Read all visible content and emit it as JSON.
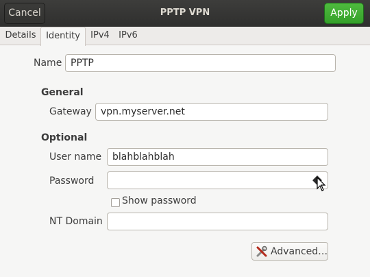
{
  "window": {
    "title": "PPTP VPN",
    "cancel_label": "Cancel",
    "apply_label": "Apply",
    "apply_color": "#3fae34"
  },
  "tabs": [
    {
      "label": "Details"
    },
    {
      "label": "Identity",
      "active": true
    },
    {
      "label": "IPv4"
    },
    {
      "label": "IPv6"
    }
  ],
  "identity": {
    "name_label": "Name",
    "name_value": "PPTP",
    "general_heading": "General",
    "gateway_label": "Gateway",
    "gateway_value": "vpn.myserver.net",
    "optional_heading": "Optional",
    "username_label": "User name",
    "username_value": "blahblahblah",
    "password_label": "Password",
    "password_value": "",
    "show_password_label": "Show password",
    "show_password_checked": false,
    "nt_domain_label": "NT Domain",
    "nt_domain_value": "",
    "advanced_label": "Advanced…",
    "advanced_icon": "tools-icon",
    "password_icon": "key-icon"
  }
}
